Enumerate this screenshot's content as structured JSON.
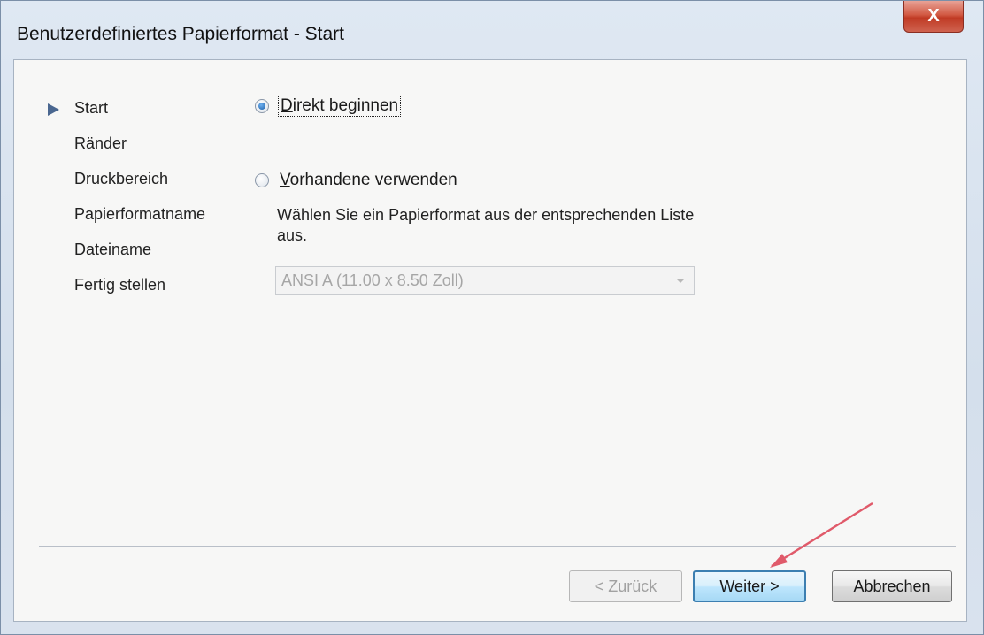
{
  "window": {
    "title": "Benutzerdefiniertes Papierformat - Start",
    "close_glyph": "X"
  },
  "nav": {
    "items": [
      {
        "label": "Start",
        "current": true
      },
      {
        "label": "Ränder"
      },
      {
        "label": "Druckbereich"
      },
      {
        "label": "Papierformatname"
      },
      {
        "label": "Dateiname"
      },
      {
        "label": "Fertig stellen"
      }
    ]
  },
  "options": {
    "direct": {
      "label": "Direkt beginnen",
      "checked": true
    },
    "existing": {
      "label": "Vorhandene verwenden",
      "checked": false
    },
    "description": "Wählen Sie ein Papierformat aus der entsprechenden Liste aus.",
    "paper_select": {
      "value": "ANSI A (11.00 x 8.50 Zoll)",
      "enabled": false
    }
  },
  "buttons": {
    "back": "< Zurück",
    "next": "Weiter >",
    "cancel": "Abbrechen"
  },
  "annotation": {
    "arrow_color": "#e05a6a"
  }
}
